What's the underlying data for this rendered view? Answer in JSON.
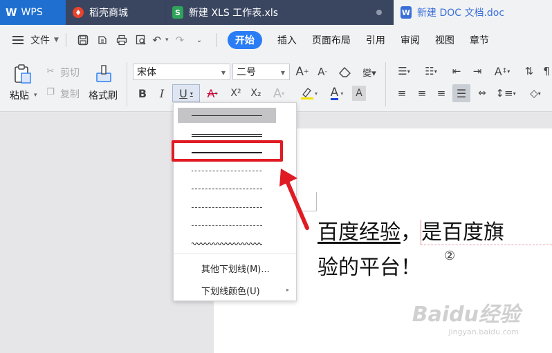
{
  "tabs": {
    "wps": "WPS",
    "daoke": "稻壳商城",
    "xls": "新建 XLS 工作表.xls",
    "doc": "新建 DOC 文档.doc"
  },
  "menu": {
    "file": "文件",
    "tabs": [
      "开始",
      "插入",
      "页面布局",
      "引用",
      "审阅",
      "视图",
      "章节"
    ]
  },
  "ribbon": {
    "paste": "粘贴",
    "cut": "剪切",
    "copy": "复制",
    "format_painter": "格式刷",
    "font_name": "宋体",
    "font_size": "二号",
    "bold": "B",
    "italic": "I",
    "underline": "U",
    "strike": "A",
    "superscript": "X²",
    "subscript": "X₂"
  },
  "underline_menu": {
    "options": [
      {
        "style": "single"
      },
      {
        "style": "double"
      },
      {
        "style": "thick"
      },
      {
        "style": "dotted"
      },
      {
        "style": "dashed"
      },
      {
        "style": "dash-dot"
      },
      {
        "style": "dash-dot-dot"
      },
      {
        "style": "wavy"
      }
    ],
    "selected_index": 0,
    "highlighted_index": 2,
    "more": "其他下划线(M)...",
    "color": "下划线颜色(U)"
  },
  "document": {
    "underlined": "百度经验",
    "line1_rest": "，是百度旗",
    "line2": "验的平台！",
    "marker": "②"
  },
  "colors": {
    "accent": "#2b7df6",
    "highlight_red": "#e01b24",
    "tabbar": "#2c3e5c"
  },
  "watermark": "Baidu经验",
  "watermark_sub": "jingyan.baidu.com"
}
